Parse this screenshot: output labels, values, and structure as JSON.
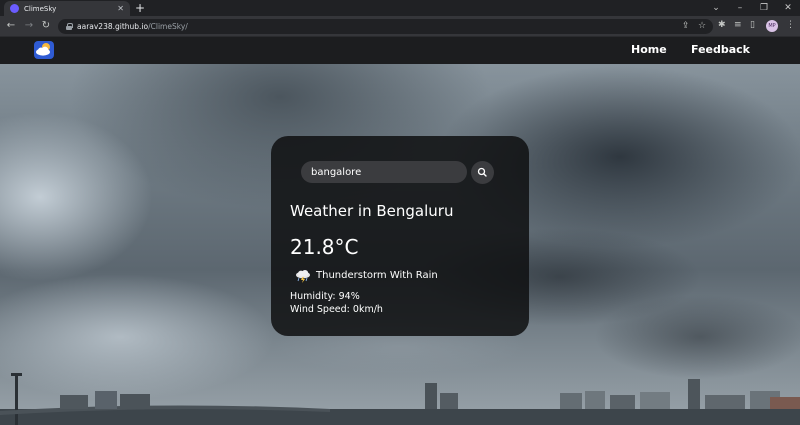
{
  "browser": {
    "tab_title": "ClimeSky",
    "url_host": "aarav238.github.io",
    "url_path": "/ClimeSky/",
    "profile_initials": "MP"
  },
  "navbar": {
    "links": [
      "Home",
      "Feedback"
    ]
  },
  "weather_card": {
    "search_value": "bangalore",
    "title": "Weather in Bengaluru",
    "temperature": "21.8°C",
    "condition": "Thunderstorm With Rain",
    "humidity": "Humidity: 94%",
    "wind": "Wind Speed: 0km/h"
  },
  "colors": {
    "card_bg": "#0f1012",
    "input_bg": "#3b3c3f",
    "logo_bg": "#2f5bd3",
    "navbar_bg": "#1c1d1f"
  },
  "icons": {
    "logo": "cloud-sun-logo-icon",
    "search": "search-icon",
    "condition": "thunderstorm-icon"
  }
}
